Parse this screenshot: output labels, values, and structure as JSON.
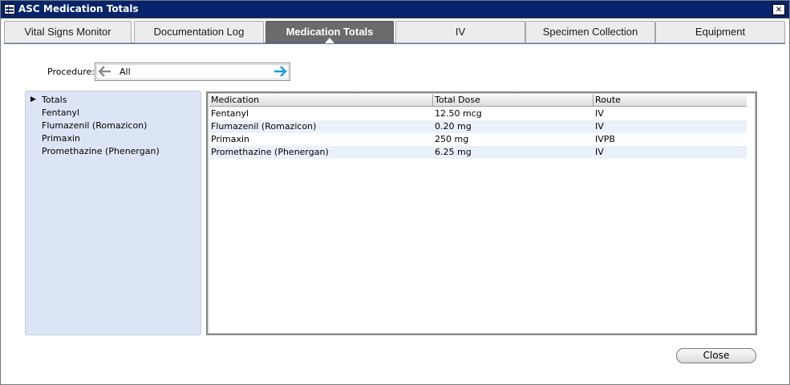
{
  "window": {
    "title": "ASC Medication Totals",
    "close_glyph": "✕"
  },
  "tabs": [
    {
      "label": "Vital Signs Monitor"
    },
    {
      "label": "Documentation Log"
    },
    {
      "label": "Medication Totals"
    },
    {
      "label": "IV"
    },
    {
      "label": "Specimen Collection"
    },
    {
      "label": "Equipment"
    }
  ],
  "active_tab": "Medication Totals",
  "procedure": {
    "label": "Procedure:",
    "value": "All",
    "prev_icon": "arrow-left-icon",
    "next_icon": "arrow-right-icon"
  },
  "tree": {
    "items": [
      {
        "label": "Totals",
        "selected": true
      },
      {
        "label": "Fentanyl"
      },
      {
        "label": "Flumazenil (Romazicon)"
      },
      {
        "label": "Primaxin"
      },
      {
        "label": "Promethazine (Phenergan)"
      }
    ],
    "selected_marker": "▶"
  },
  "table": {
    "columns": [
      "Medication",
      "Total Dose",
      "Route"
    ],
    "rows": [
      [
        "Fentanyl",
        "12.50 mcg",
        "IV"
      ],
      [
        "Flumazenil (Romazicon)",
        "0.20 mg",
        "IV"
      ],
      [
        "Primaxin",
        "250 mg",
        "IVPB"
      ],
      [
        "Promethazine (Phenergan)",
        "6.25 mg",
        "IV"
      ]
    ]
  },
  "buttons": {
    "close": "Close"
  },
  "colors": {
    "titlebar": "#06246b",
    "active_tab": "#6b6b6b",
    "tree_bg": "#dce5f5",
    "next_arrow": "#1e9be0",
    "prev_arrow": "#8a8a8a"
  }
}
